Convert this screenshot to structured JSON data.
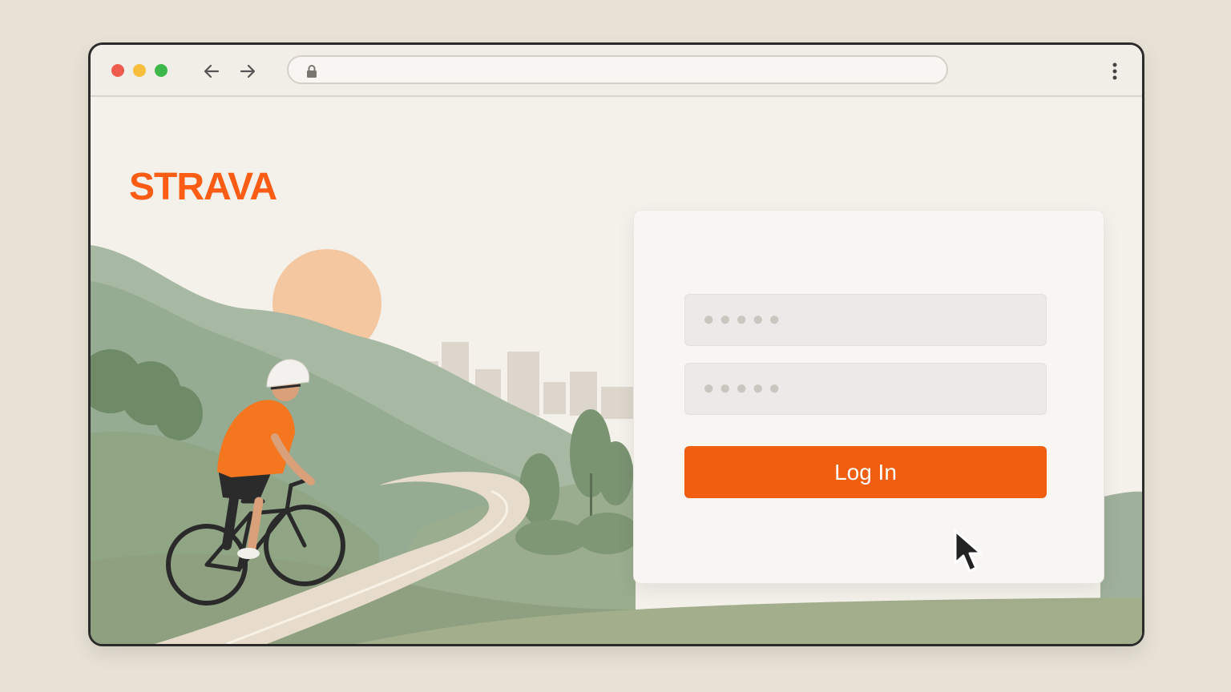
{
  "browser": {
    "url": "",
    "traffic_lights": {
      "close": "#ef5b4c",
      "minimize": "#f6be3b",
      "maximize": "#3fb84b"
    }
  },
  "brand": {
    "logo_text": "STRAVA",
    "accent": "#fc5c14"
  },
  "login": {
    "username_placeholder": "●●●●●",
    "password_placeholder": "●●●●●",
    "button_label": "Log In",
    "button_color": "#f25e0f"
  },
  "icons": {
    "back": "arrow-left-icon",
    "forward": "arrow-right-icon",
    "lock": "lock-icon",
    "menu": "kebab-menu-icon",
    "cursor": "mouse-pointer-icon"
  }
}
